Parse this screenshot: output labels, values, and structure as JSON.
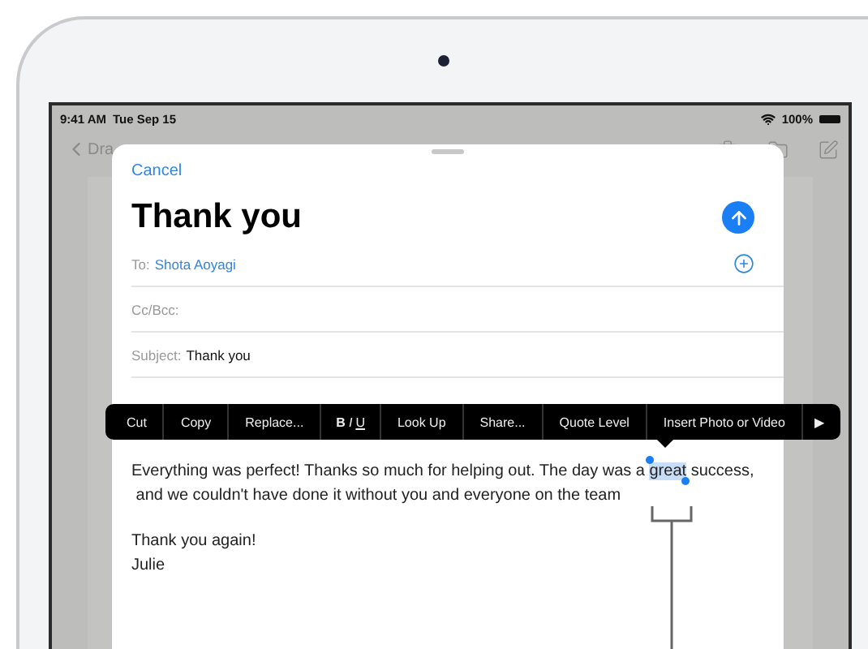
{
  "status_bar": {
    "time": "9:41 AM",
    "date": "Tue Sep 15",
    "battery": "100%"
  },
  "background_nav": {
    "back_label": "Dra"
  },
  "compose": {
    "cancel": "Cancel",
    "title": "Thank you",
    "fields": [
      {
        "label": "To:",
        "value": "Shota Aoyagi",
        "kind": "recipient"
      },
      {
        "label": "Cc/Bcc:",
        "kind": "empty"
      },
      {
        "label": "Subject:",
        "value": "Thank you",
        "kind": "plain"
      }
    ],
    "body": [
      {
        "segments": [
          {
            "text": "Everything was perfect! Thanks so much for helping out. The day was a ",
            "selected": false
          },
          {
            "text": "great",
            "selected": true
          },
          {
            "text": " success,\n and we couldn't have done it without you and everyone on the team",
            "selected": false
          }
        ]
      },
      {
        "segments": [
          {
            "text": "Thank you again!\nJulie",
            "selected": false
          }
        ]
      }
    ]
  },
  "edit_menu": [
    {
      "kind": "text",
      "label": "Cut"
    },
    {
      "kind": "text",
      "label": "Copy"
    },
    {
      "kind": "text",
      "label": "Replace..."
    },
    {
      "kind": "format",
      "letters": [
        "B",
        "I",
        "U"
      ]
    },
    {
      "kind": "text",
      "label": "Look Up"
    },
    {
      "kind": "text",
      "label": "Share..."
    },
    {
      "kind": "text",
      "label": "Quote Level"
    },
    {
      "kind": "text",
      "label": "Insert Photo or Video"
    },
    {
      "kind": "more",
      "label": "▶"
    }
  ]
}
